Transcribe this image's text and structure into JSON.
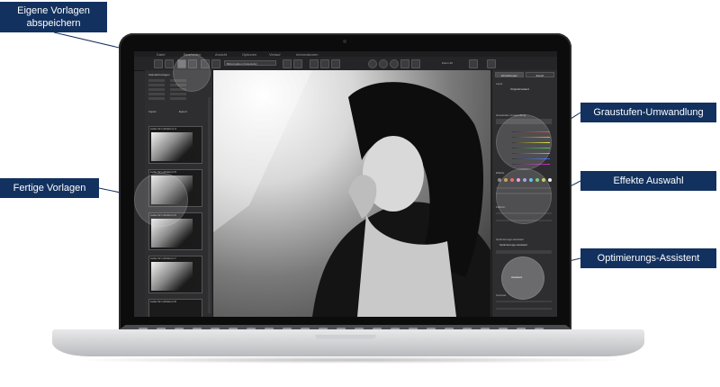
{
  "callouts": {
    "eigene_vorlagen_line1": "Eigene Vorlagen",
    "eigene_vorlagen_line2": "abspeichern",
    "fertige_vorlagen": "Fertige Vorlagen",
    "graustufen": "Graustufen-Umwandlung",
    "effekte": "Effekte Auswahl",
    "optimierung": "Optimierungs-Assistent"
  },
  "app": {
    "menu": [
      "Datei",
      "Bearbeiten",
      "Ansicht",
      "Optionen",
      "Verlauf",
      "Informationen"
    ],
    "preset_select": "Bildvorgaben (Graustufe)",
    "left_header": "Standardvorlagen",
    "template_labels": [
      "Liebe für Lichtstrom 4",
      "Liebe für Lichtstrom 5",
      "Liebe für Lichtstrom 6",
      "Liebe für Lichtstrom 7",
      "Liebe für Lichtstrom 8"
    ],
    "left_buttons": [
      "Import",
      "Export"
    ],
    "right_tabs": [
      "Einstellungen",
      "Export"
    ],
    "right_sections": [
      "Layer",
      "Graustufen-Umwandlung",
      "Effekte",
      "Optimierungs-Assistent",
      "Farbton",
      "Kontrast"
    ],
    "layer_value": "Originalzustand",
    "optimizer_value": "Optimierungs-Assistent",
    "assist_button": "Assistent",
    "zoom": "Zoom 20"
  },
  "colors": {
    "callout_bg": "#12315f",
    "callout_text": "#ffffff",
    "app_bg": "#2e2e30"
  }
}
